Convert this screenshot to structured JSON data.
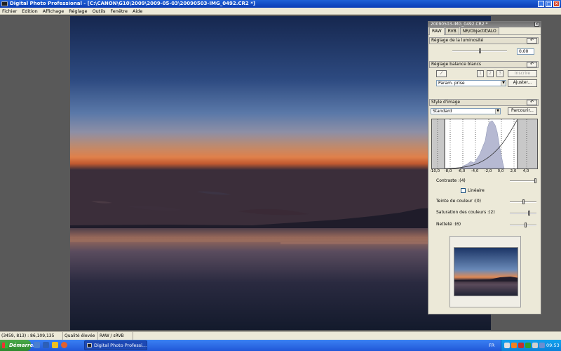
{
  "window": {
    "title": "Digital Photo Professional - [C:\\CANON\\G10\\2009\\2009-05-03\\20090503-IMG_0492.CR2 *]"
  },
  "menu": [
    "Fichier",
    "Edition",
    "Affichage",
    "Réglage",
    "Outils",
    "Fenêtre",
    "Aide"
  ],
  "palette": {
    "title": "20090503-IMG_0492.CR2 *",
    "tabs": [
      "RAW",
      "RVB",
      "NR/Objectif/ALO"
    ],
    "active_tab": "RAW",
    "brightness": {
      "heading": "Réglage de la luminosité",
      "value": "0,00",
      "level": 0.5
    },
    "white_balance": {
      "heading": "Réglage balance blancs",
      "register_label": "Inscrire",
      "preset": "Param. prise",
      "adjust_label": "Ajuster..."
    },
    "picture_style": {
      "heading": "Style d'image",
      "style": "Standard",
      "browse_label": "Parcourir...",
      "axis_ticks": [
        "-10,0",
        "-8,0",
        "-6,0",
        "-4,0",
        "-2,0",
        "0,0",
        "2,0",
        "4,0"
      ],
      "contrast_label": "Contraste :(4)",
      "contrast_level": 1.0,
      "linear_label": "Linéaire",
      "linear_checked": false,
      "tone_label": "Teinte de couleur :(0)",
      "tone_level": 0.5,
      "saturation_label": "Saturation des couleurs :(2)",
      "saturation_level": 0.75,
      "sharpness_label": "Netteté :(6)",
      "sharpness_level": 0.6
    }
  },
  "status": {
    "coords": "(3459, 813) : 86,109,135",
    "quality": "Qualité élevée",
    "colorspace": "RAW / sRVB"
  },
  "taskbar": {
    "start_label": "Démarrer",
    "task_label": "Digital Photo Professi...",
    "lang": "FR",
    "clock": "09:53"
  }
}
